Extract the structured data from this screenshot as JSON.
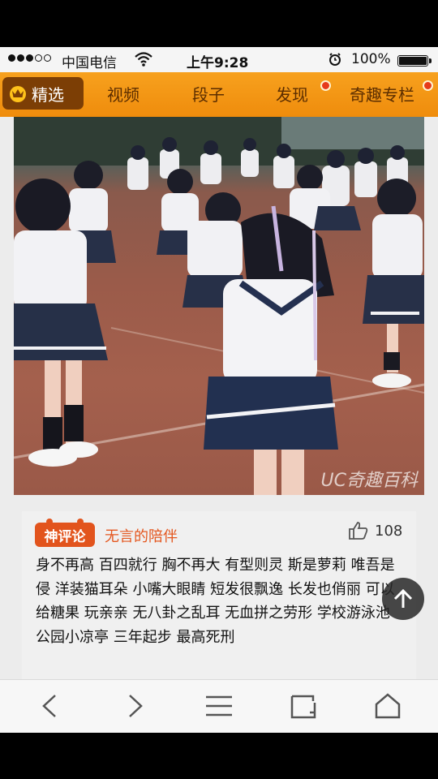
{
  "status_bar": {
    "carrier": "中国电信",
    "time": "上午9:28",
    "battery": "100%",
    "signal_bars": 3,
    "signal_total": 5
  },
  "tabs": [
    {
      "label": "精选",
      "active": true,
      "icon": "crown-icon"
    },
    {
      "label": "视频"
    },
    {
      "label": "段子"
    },
    {
      "label": "发现",
      "dot": true
    },
    {
      "label": "奇趣专栏",
      "dot": true
    }
  ],
  "post": {
    "watermark": "UC奇趣百科",
    "comment": {
      "badge": "神评论",
      "username": "无言的陪伴",
      "likes": "108",
      "text": "身不再高 百四就行 胸不再大 有型则灵 斯是萝莉 唯吾是侵 洋装猫耳朵 小嘴大眼睛 短发很飘逸 长发也俏丽 可以给糖果 玩亲亲 无八卦之乱耳 无血拼之劳形 学校游泳池 公园小凉亭 三年起步 最高死刑"
    }
  },
  "toolbar": [
    "back-icon",
    "forward-icon",
    "menu-icon",
    "tabs-icon",
    "home-icon"
  ],
  "colors": {
    "tab_bar": "#ef8c0c",
    "accent": "#e4571f"
  }
}
